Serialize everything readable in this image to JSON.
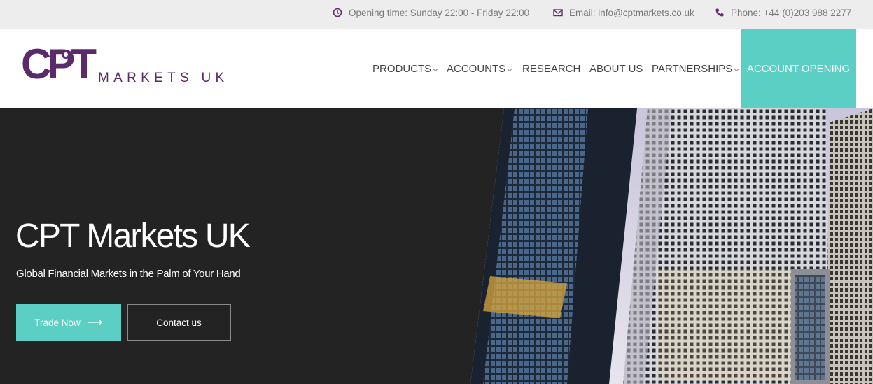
{
  "topbar": {
    "hours": "Opening time: Sunday 22:00 - Friday 22:00",
    "email": "Email: info@cptmarkets.co.uk",
    "phone": "Phone: +44 (0)203 988 2277"
  },
  "logo": {
    "mark": "CPT",
    "subtitle": "MARKETS UK"
  },
  "nav": {
    "products": "PRODUCTS",
    "accounts": "ACCOUNTS",
    "research": "RESEARCH",
    "about": "ABOUT US",
    "partnerships": "PARTNERSHIPS",
    "account_opening": "ACCOUNT OPENING"
  },
  "hero": {
    "title": "CPT Markets UK",
    "subtitle": "Global Financial Markets in the Palm of Your Hand",
    "trade_label": "Trade Now",
    "contact_label": "Contact us"
  },
  "colors": {
    "brand_purple": "#5a2a6a",
    "accent_teal": "#5ccfc5",
    "hero_bg": "#232323",
    "topbar_bg": "#ededed"
  }
}
